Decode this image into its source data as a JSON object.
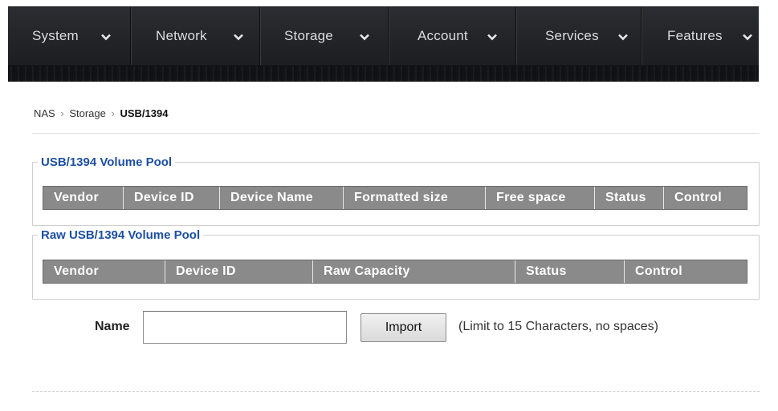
{
  "nav": {
    "items": [
      {
        "label": "System"
      },
      {
        "label": "Network"
      },
      {
        "label": "Storage"
      },
      {
        "label": "Account"
      },
      {
        "label": "Services"
      },
      {
        "label": "Features"
      }
    ]
  },
  "breadcrumb": {
    "root": "NAS",
    "section": "Storage",
    "separator": "›",
    "current": "USB/1394"
  },
  "pool": {
    "legend": "USB/1394 Volume Pool",
    "columns": [
      "Vendor",
      "Device ID",
      "Device Name",
      "Formatted size",
      "Free space",
      "Status",
      "Control"
    ]
  },
  "raw_pool": {
    "legend": "Raw USB/1394 Volume Pool",
    "columns": [
      "Vendor",
      "Device ID",
      "Raw Capacity",
      "Status",
      "Control"
    ]
  },
  "import_form": {
    "name_label": "Name",
    "name_value": "",
    "import_label": "Import",
    "hint": "(Limit to 15 Characters, no spaces)"
  }
}
